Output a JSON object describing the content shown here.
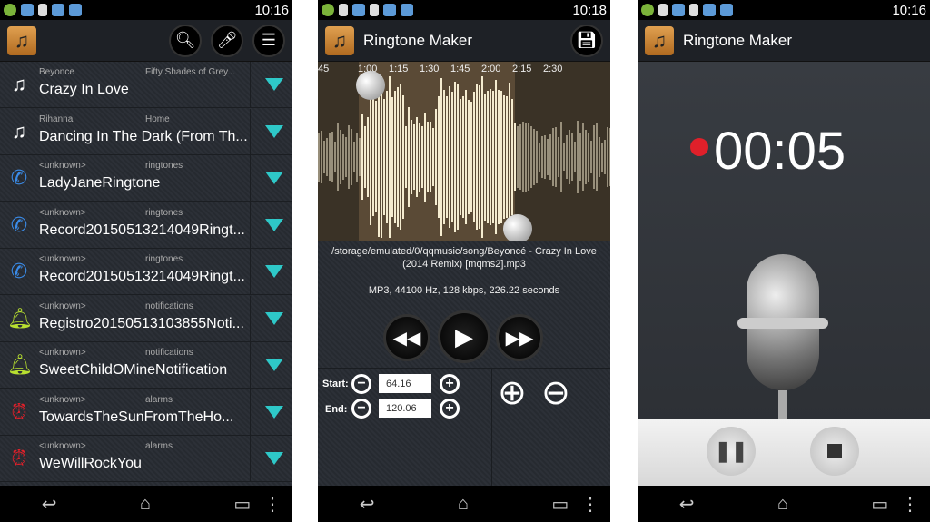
{
  "status": {
    "p1_time": "10:16",
    "p2_time": "10:18",
    "p3_time": "10:16"
  },
  "app_title": "Ringtone Maker",
  "list": [
    {
      "artist": "Beyonce",
      "album": "Fifty Shades of Grey...",
      "title": "Crazy In Love",
      "icon": "music-note"
    },
    {
      "artist": "Rihanna",
      "album": "Home",
      "title": "Dancing In The Dark (From Th...",
      "icon": "music-note"
    },
    {
      "artist": "<unknown>",
      "album": "ringtones",
      "title": "LadyJaneRingtone",
      "icon": "phone-ringtone"
    },
    {
      "artist": "<unknown>",
      "album": "ringtones",
      "title": "Record20150513214049Ringt...",
      "icon": "phone-ringtone"
    },
    {
      "artist": "<unknown>",
      "album": "ringtones",
      "title": "Record20150513214049Ringt...",
      "icon": "phone-ringtone"
    },
    {
      "artist": "<unknown>",
      "album": "notifications",
      "title": "Registro20150513103855Noti...",
      "icon": "bell"
    },
    {
      "artist": "<unknown>",
      "album": "notifications",
      "title": "SweetChildOMineNotification",
      "icon": "bell"
    },
    {
      "artist": "<unknown>",
      "album": "alarms",
      "title": "TowardsTheSunFromTheHo...",
      "icon": "alarm-clock"
    },
    {
      "artist": "<unknown>",
      "album": "alarms",
      "title": "WeWillRockYou",
      "icon": "alarm-clock"
    }
  ],
  "editor": {
    "timeline": [
      "45",
      "1:00",
      "1:15",
      "1:30",
      "1:45",
      "2:00",
      "2:15",
      "2:30"
    ],
    "path": "/storage/emulated/0/qqmusic/song/Beyoncé - Crazy In Love",
    "path2": "(2014 Remix) [mqms2].mp3",
    "format": "MP3, 44100 Hz, 128 kbps, 226.22 seconds",
    "start_label": "Start:",
    "start_value": "64.16",
    "end_label": "End:",
    "end_value": "120.06"
  },
  "recorder": {
    "timer": "00:05"
  },
  "colors": {
    "accent": "#2ec8c8",
    "record": "#e0202a"
  }
}
